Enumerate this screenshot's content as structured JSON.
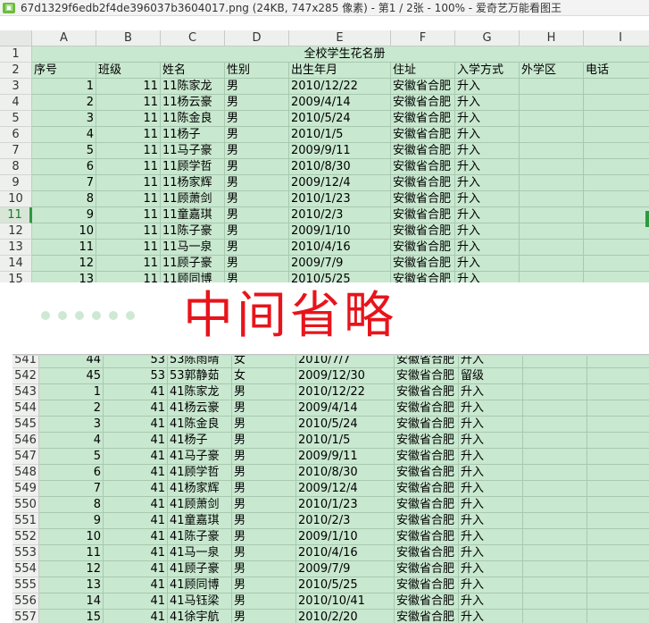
{
  "window": {
    "title": "67d1329f6edb2f4de396037b3604017.png (24KB, 747x285 像素) - 第1 / 2张 - 100% - 爱奇艺万能看图王"
  },
  "columns": [
    "A",
    "B",
    "C",
    "D",
    "E",
    "F",
    "G",
    "H",
    "I"
  ],
  "sheet_title": "全校学生花名册",
  "headers": [
    "序号",
    "班级",
    "姓名",
    "性别",
    "出生年月",
    "住址",
    "入学方式",
    "外学区",
    "电话"
  ],
  "top_rows": [
    {
      "r": "3",
      "seq": "1",
      "cls": "11",
      "name": "11陈家龙",
      "sex": "男",
      "birth": "2010/12/22",
      "addr": "安徽省合肥",
      "mode": "升入"
    },
    {
      "r": "4",
      "seq": "2",
      "cls": "11",
      "name": "11杨云豪",
      "sex": "男",
      "birth": "2009/4/14",
      "addr": "安徽省合肥",
      "mode": "升入"
    },
    {
      "r": "5",
      "seq": "3",
      "cls": "11",
      "name": "11陈金良",
      "sex": "男",
      "birth": "2010/5/24",
      "addr": "安徽省合肥",
      "mode": "升入"
    },
    {
      "r": "6",
      "seq": "4",
      "cls": "11",
      "name": "11杨子",
      "sex": "男",
      "birth": "2010/1/5",
      "addr": "安徽省合肥",
      "mode": "升入"
    },
    {
      "r": "7",
      "seq": "5",
      "cls": "11",
      "name": "11马子豪",
      "sex": "男",
      "birth": "2009/9/11",
      "addr": "安徽省合肥",
      "mode": "升入"
    },
    {
      "r": "8",
      "seq": "6",
      "cls": "11",
      "name": "11顾学哲",
      "sex": "男",
      "birth": "2010/8/30",
      "addr": "安徽省合肥",
      "mode": "升入"
    },
    {
      "r": "9",
      "seq": "7",
      "cls": "11",
      "name": "11杨家辉",
      "sex": "男",
      "birth": "2009/12/4",
      "addr": "安徽省合肥",
      "mode": "升入"
    },
    {
      "r": "10",
      "seq": "8",
      "cls": "11",
      "name": "11顾萧剑",
      "sex": "男",
      "birth": "2010/1/23",
      "addr": "安徽省合肥",
      "mode": "升入"
    },
    {
      "r": "11",
      "seq": "9",
      "cls": "11",
      "name": "11童嘉琪",
      "sex": "男",
      "birth": "2010/2/3",
      "addr": "安徽省合肥",
      "mode": "升入"
    },
    {
      "r": "12",
      "seq": "10",
      "cls": "11",
      "name": "11陈子豪",
      "sex": "男",
      "birth": "2009/1/10",
      "addr": "安徽省合肥",
      "mode": "升入"
    },
    {
      "r": "13",
      "seq": "11",
      "cls": "11",
      "name": "11马一泉",
      "sex": "男",
      "birth": "2010/4/16",
      "addr": "安徽省合肥",
      "mode": "升入"
    },
    {
      "r": "14",
      "seq": "12",
      "cls": "11",
      "name": "11顾子豪",
      "sex": "男",
      "birth": "2009/7/9",
      "addr": "安徽省合肥",
      "mode": "升入"
    },
    {
      "r": "15",
      "seq": "13",
      "cls": "11",
      "name": "11顾同博",
      "sex": "男",
      "birth": "2010/5/25",
      "addr": "安徽省合肥",
      "mode": "升入"
    }
  ],
  "omitted_label": "中间省略",
  "bottom_rows": [
    {
      "r": "541",
      "seq": "44",
      "cls": "53",
      "name": "53陈雨晴",
      "sex": "女",
      "birth": "2010/7/7",
      "addr": "安徽省合肥",
      "mode": "升入"
    },
    {
      "r": "542",
      "seq": "45",
      "cls": "53",
      "name": "53郭静茹",
      "sex": "女",
      "birth": "2009/12/30",
      "addr": "安徽省合肥",
      "mode": "留级"
    },
    {
      "r": "543",
      "seq": "1",
      "cls": "41",
      "name": "41陈家龙",
      "sex": "男",
      "birth": "2010/12/22",
      "addr": "安徽省合肥",
      "mode": "升入"
    },
    {
      "r": "544",
      "seq": "2",
      "cls": "41",
      "name": "41杨云豪",
      "sex": "男",
      "birth": "2009/4/14",
      "addr": "安徽省合肥",
      "mode": "升入"
    },
    {
      "r": "545",
      "seq": "3",
      "cls": "41",
      "name": "41陈金良",
      "sex": "男",
      "birth": "2010/5/24",
      "addr": "安徽省合肥",
      "mode": "升入"
    },
    {
      "r": "546",
      "seq": "4",
      "cls": "41",
      "name": "41杨子",
      "sex": "男",
      "birth": "2010/1/5",
      "addr": "安徽省合肥",
      "mode": "升入"
    },
    {
      "r": "547",
      "seq": "5",
      "cls": "41",
      "name": "41马子豪",
      "sex": "男",
      "birth": "2009/9/11",
      "addr": "安徽省合肥",
      "mode": "升入"
    },
    {
      "r": "548",
      "seq": "6",
      "cls": "41",
      "name": "41顾学哲",
      "sex": "男",
      "birth": "2010/8/30",
      "addr": "安徽省合肥",
      "mode": "升入"
    },
    {
      "r": "549",
      "seq": "7",
      "cls": "41",
      "name": "41杨家辉",
      "sex": "男",
      "birth": "2009/12/4",
      "addr": "安徽省合肥",
      "mode": "升入"
    },
    {
      "r": "550",
      "seq": "8",
      "cls": "41",
      "name": "41顾萧剑",
      "sex": "男",
      "birth": "2010/1/23",
      "addr": "安徽省合肥",
      "mode": "升入"
    },
    {
      "r": "551",
      "seq": "9",
      "cls": "41",
      "name": "41童嘉琪",
      "sex": "男",
      "birth": "2010/2/3",
      "addr": "安徽省合肥",
      "mode": "升入"
    },
    {
      "r": "552",
      "seq": "10",
      "cls": "41",
      "name": "41陈子豪",
      "sex": "男",
      "birth": "2009/1/10",
      "addr": "安徽省合肥",
      "mode": "升入"
    },
    {
      "r": "553",
      "seq": "11",
      "cls": "41",
      "name": "41马一泉",
      "sex": "男",
      "birth": "2010/4/16",
      "addr": "安徽省合肥",
      "mode": "升入"
    },
    {
      "r": "554",
      "seq": "12",
      "cls": "41",
      "name": "41顾子豪",
      "sex": "男",
      "birth": "2009/7/9",
      "addr": "安徽省合肥",
      "mode": "升入"
    },
    {
      "r": "555",
      "seq": "13",
      "cls": "41",
      "name": "41顾同博",
      "sex": "男",
      "birth": "2010/5/25",
      "addr": "安徽省合肥",
      "mode": "升入"
    },
    {
      "r": "556",
      "seq": "14",
      "cls": "41",
      "name": "41马钰梁",
      "sex": "男",
      "birth": "2010/10/41",
      "addr": "安徽省合肥",
      "mode": "升入"
    },
    {
      "r": "557",
      "seq": "15",
      "cls": "41",
      "name": "41徐宇航",
      "sex": "男",
      "birth": "2010/2/20",
      "addr": "安徽省合肥",
      "mode": "升入"
    }
  ],
  "active_row": "11"
}
